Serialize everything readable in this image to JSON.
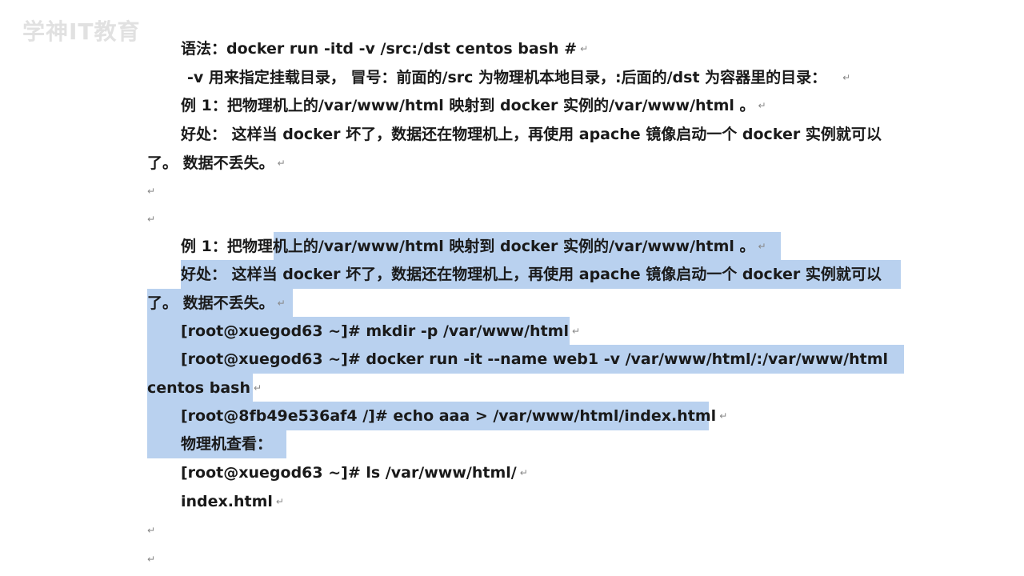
{
  "watermark": "学神IT教育",
  "lines": {
    "l1": "语法：docker  run  -itd  -v  /src:/dst  centos    bash        #",
    "l2": "-v  用来指定挂载目录，   冒号：前面的/src 为物理机本地目录，:后面的/dst   为容器里的目录：",
    "l3": "例 1：把物理机上的/var/www/html 映射到 docker 实例的/var/www/html   。",
    "l4": "好处：  这样当 docker 坏了，数据还在物理机上，再使用 apache 镜像启动一个 docker 实例就可以",
    "l5": "了。  数据不丢失。",
    "l8": "例 1：把物理机上的/var/www/html 映射到 docker 实例的/var/www/html   。",
    "l9": "好处：  这样当 docker 坏了，数据还在物理机上，再使用 apache 镜像启动一个 docker 实例就可以",
    "l10": "了。  数据不丢失。",
    "l11": "[root@xuegod63  ~]# mkdir -p /var/www/html",
    "l12": "[root@xuegod63  ~]# docker run   -it --name web1 -v /var/www/html/:/var/www/html",
    "l13": "centos bash",
    "l14": "[root@8fb49e536af4  /]# echo aaa > /var/www/html/index.html",
    "l15": "物理机查看：",
    "l16": "[root@xuegod63  ~]# ls /var/www/html/",
    "l17": "index.html"
  },
  "paragraph_mark": "↵"
}
